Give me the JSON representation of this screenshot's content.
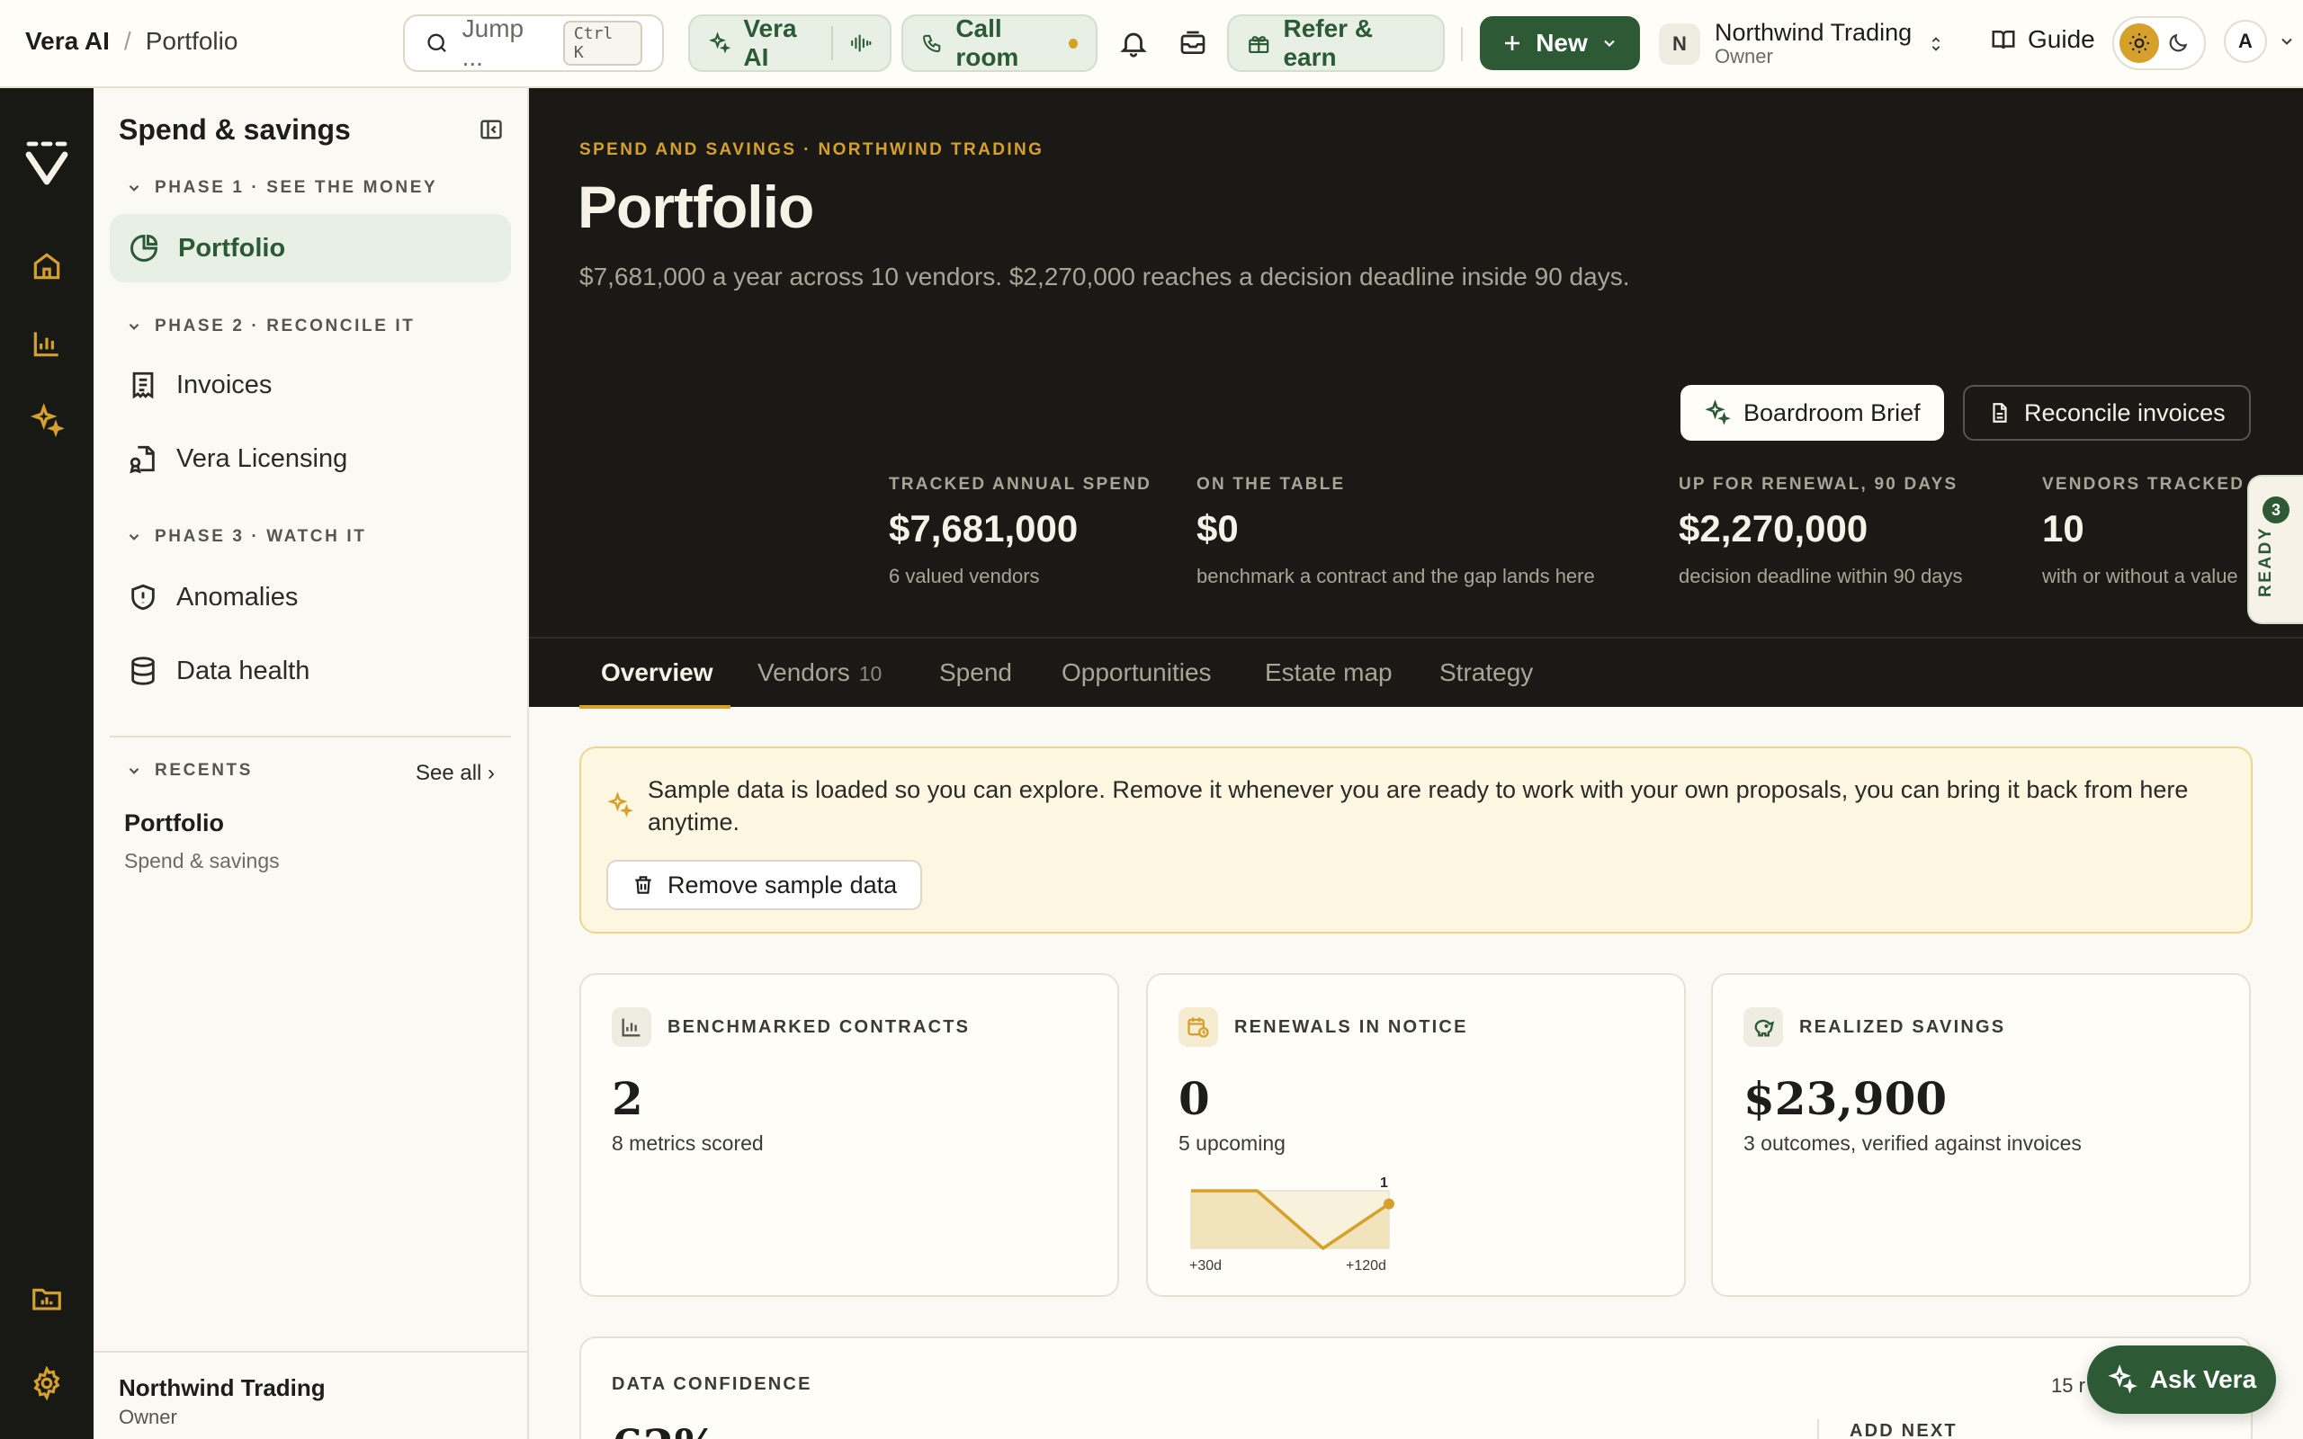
{
  "breadcrumb": {
    "app": "Vera AI",
    "separator": "/",
    "current": "Portfolio"
  },
  "topbar": {
    "search_label": "Jump ...",
    "search_shortcut": "Ctrl K",
    "vera_ai_label": "Vera AI",
    "call_room_label": "Call room",
    "refer_label": "Refer & earn",
    "new_label": "New",
    "org": {
      "initial": "N",
      "name": "Northwind Trading",
      "role": "Owner"
    },
    "guide_label": "Guide",
    "user_initial": "A"
  },
  "sidebar": {
    "title": "Spend & savings",
    "phases": [
      {
        "label": "PHASE 1 · SEE THE MONEY",
        "items": [
          {
            "label": "Portfolio",
            "active": true
          }
        ]
      },
      {
        "label": "PHASE 2 · RECONCILE IT",
        "items": [
          {
            "label": "Invoices"
          },
          {
            "label": "Vera Licensing"
          }
        ]
      },
      {
        "label": "PHASE 3 · WATCH IT",
        "items": [
          {
            "label": "Anomalies"
          },
          {
            "label": "Data health"
          }
        ]
      }
    ],
    "recents": {
      "label": "RECENTS",
      "see_all": "See all ›",
      "items": [
        {
          "title": "Portfolio",
          "subtitle": "Spend & savings"
        }
      ]
    },
    "footer": {
      "name": "Northwind Trading",
      "role": "Owner"
    }
  },
  "hero": {
    "eyebrow": "SPEND AND SAVINGS · NORTHWIND TRADING",
    "title": "Portfolio",
    "lede": "$7,681,000 a year across 10 vendors. $2,270,000 reaches a decision deadline inside 90 days.",
    "buttons": {
      "brief": "Boardroom Brief",
      "reconcile": "Reconcile invoices"
    },
    "stats": [
      {
        "label": "TRACKED ANNUAL SPEND",
        "value": "$7,681,000",
        "sub": "6 valued vendors"
      },
      {
        "label": "ON THE TABLE",
        "value": "$0",
        "sub": "benchmark a contract and the gap lands here"
      },
      {
        "label": "UP FOR RENEWAL, 90 DAYS",
        "value": "$2,270,000",
        "sub": "decision deadline within 90 days"
      },
      {
        "label": "VENDORS TRACKED",
        "value": "10",
        "sub": "with or without a value"
      }
    ]
  },
  "tabs": [
    {
      "label": "Overview",
      "active": true
    },
    {
      "label": "Vendors",
      "count": "10"
    },
    {
      "label": "Spend"
    },
    {
      "label": "Opportunities"
    },
    {
      "label": "Estate map"
    },
    {
      "label": "Strategy"
    }
  ],
  "ready_badge": {
    "count": "3",
    "label": "READY"
  },
  "banner": {
    "text": "Sample data is loaded so you can explore. Remove it whenever you are ready to work with your own proposals, you can bring it back from here anytime.",
    "button": "Remove sample data"
  },
  "cards": [
    {
      "label": "BENCHMARKED CONTRACTS",
      "value": "2",
      "sub": "8 metrics scored",
      "icon": "bar-chart-icon"
    },
    {
      "label": "RENEWALS IN NOTICE",
      "value": "0",
      "sub": "5 upcoming",
      "icon": "calendar-clock-icon",
      "sparkline": {
        "x_labels": [
          "+30d",
          "+120d"
        ],
        "values": [
          0,
          0,
          0,
          1
        ],
        "end_label": "1"
      }
    },
    {
      "label": "REALIZED SAVINGS",
      "value": "$23,900",
      "sub": "3 outcomes, verified against invoices",
      "icon": "piggy-bank-icon"
    }
  ],
  "confidence": {
    "label": "DATA CONFIDENCE",
    "count": "15 r",
    "value": "62%",
    "next_label": "ADD NEXT"
  },
  "ask_vera": "Ask Vera",
  "colors": {
    "brand_green": "#2d5a34",
    "accent_gold": "#d6a12b",
    "hero_bg": "#1a1915",
    "page_bg": "#fbf9f3"
  }
}
